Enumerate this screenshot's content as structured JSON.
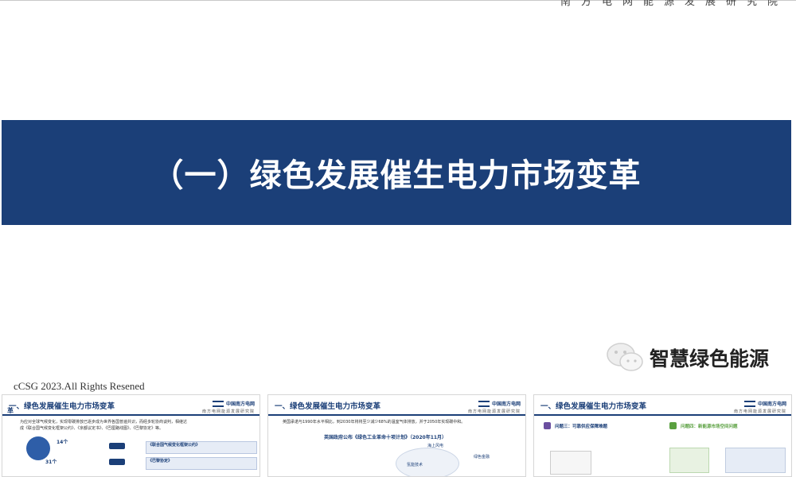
{
  "header": {
    "org": "南方电网能源发展研究院"
  },
  "banner": {
    "title": "（一）绿色发展催生电力市场变革"
  },
  "watermark": {
    "text": "智慧绿色能源"
  },
  "footer": {
    "copyright": "cCSG 2023.All Rights Resened"
  },
  "thumbnails": [
    {
      "title": "一、绿色发展催生电力市场变革",
      "logo": "中国南方电网",
      "logo_sub": "南方电网能源发展研究院",
      "side_label": "革",
      "line1": "为应对全球气候变化，实现零碳排放已逐步成为世界各国普遍共识，而经多轮协商谈判，相继达",
      "line2": "成《联合国气候变化框架公约》、《京都议定书》、《巴厘路线图》、《巴黎协定》等。",
      "stat1": "14个",
      "stat2": "31个",
      "box1": "《联合国气候变化框架公约》",
      "box2": "《巴黎协定》"
    },
    {
      "title": "一、绿色发展催生电力市场变革",
      "logo": "中国南方电网",
      "logo_sub": "南方电网能源发展研究院",
      "line1": "英国承诺与1990年水平相比，到2030年将将至少减少68%的温室气体排放，并于2050年实现碳中和。",
      "subtitle": "英国政府公布《绿色工业革命十项计划》（2020年11月）",
      "item1": "海上风电",
      "item2": "氢能技术",
      "item3": "绿色金融"
    },
    {
      "title": "一、绿色发展催生电力市场变革",
      "logo": "中国南方电网",
      "logo_sub": "南方电网能源发展研究院",
      "item1": "问题三：可靠供应保障难题",
      "item2": "问题四：新能源市场空间问题"
    }
  ]
}
